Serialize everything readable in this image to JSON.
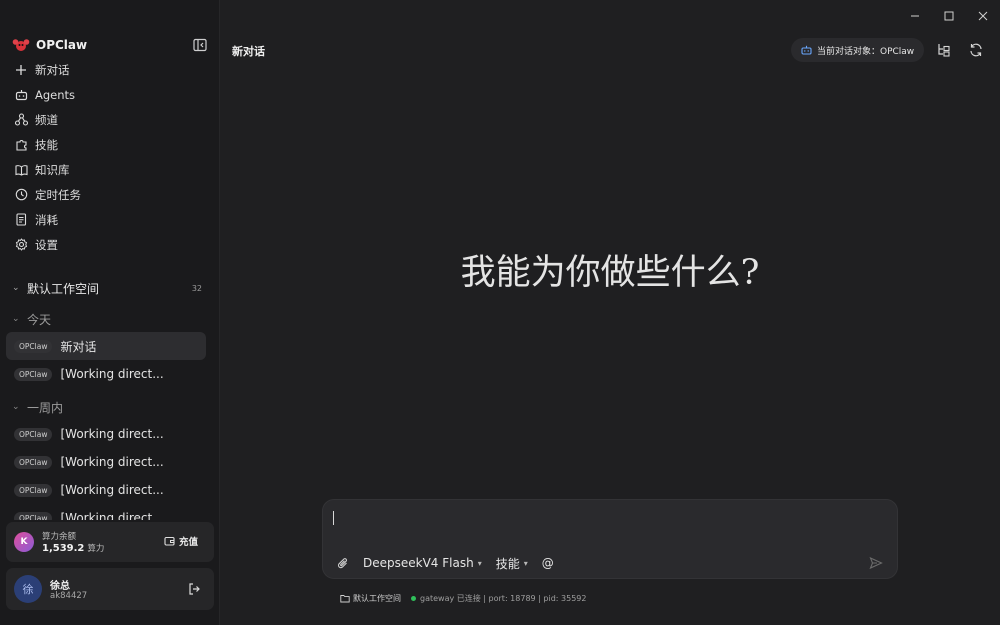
{
  "window": {
    "controls": [
      "minimize",
      "maximize",
      "close"
    ]
  },
  "sidebar": {
    "brand": "OPClaw",
    "nav": [
      {
        "label": "新对话",
        "icon": "plus-icon"
      },
      {
        "label": "Agents",
        "icon": "robot-icon"
      },
      {
        "label": "频道",
        "icon": "channels-icon"
      },
      {
        "label": "技能",
        "icon": "puzzle-icon"
      },
      {
        "label": "知识库",
        "icon": "book-icon"
      },
      {
        "label": "定时任务",
        "icon": "clock-icon"
      },
      {
        "label": "消耗",
        "icon": "receipt-icon"
      },
      {
        "label": "设置",
        "icon": "gear-icon"
      }
    ],
    "workspace": {
      "name": "默认工作空间",
      "count": "32"
    },
    "groups": {
      "today": {
        "label": "今天",
        "items": [
          {
            "tag": "OPClaw",
            "title": "新对话"
          },
          {
            "tag": "OPClaw",
            "title": "[Working direct..."
          }
        ]
      },
      "week": {
        "label": "一周内",
        "items": [
          {
            "tag": "OPClaw",
            "title": "[Working direct..."
          },
          {
            "tag": "OPClaw",
            "title": "[Working direct..."
          },
          {
            "tag": "OPClaw",
            "title": "[Working direct..."
          },
          {
            "tag": "OPClaw",
            "title": "[Working direct..."
          }
        ]
      }
    },
    "credit": {
      "avatar": "K",
      "label": "算力余额",
      "value": "1,539.2",
      "unit": "算力",
      "recharge": "充值"
    },
    "user": {
      "avatar": "徐",
      "name": "徐总",
      "id": "ak84427"
    }
  },
  "main": {
    "title": "新对话",
    "target": "当前对话对象：OPClaw",
    "hero": "我能为你做些什么?",
    "composer": {
      "placeholder": "",
      "model": "DeepseekV4 Flash",
      "skills": "技能",
      "mention": "@"
    },
    "status": {
      "workspace": "默认工作空间",
      "gateway": "gateway 已连接 | port: 18789 | pid: 35592"
    }
  },
  "colors": {
    "accent_green": "#2fbf5a",
    "avatar_blue": "#2b3f76",
    "background": "#1f1f21"
  }
}
